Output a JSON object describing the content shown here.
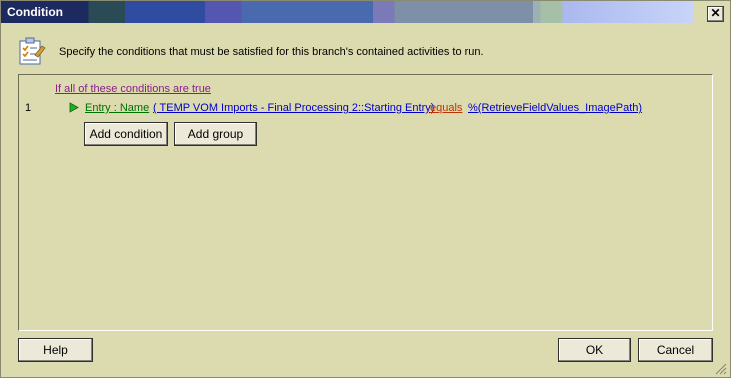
{
  "window": {
    "title": "Condition",
    "close_glyph": "✕"
  },
  "header": {
    "instruction": "Specify the conditions that must be satisfied for this branch's contained activities to run.",
    "icon": "checklist-icon"
  },
  "conditions": {
    "group_header": "If all of these conditions are true",
    "rows": [
      {
        "number": "1",
        "field": "Entry : Name",
        "source": "( TEMP VOM Imports - Final Processing 2::Starting Entry)",
        "operator": "equals",
        "value": "%(RetrieveFieldValues_ImagePath)"
      }
    ],
    "add_condition_label": "Add condition",
    "add_group_label": "Add group"
  },
  "footer": {
    "help_label": "Help",
    "ok_label": "OK",
    "cancel_label": "Cancel"
  },
  "colors": {
    "dialog_bg": "#dcdbaf",
    "field_link": "#007000",
    "source_link": "#0000cc",
    "operator_link": "#c03000",
    "group_link": "#8b1c8b"
  }
}
